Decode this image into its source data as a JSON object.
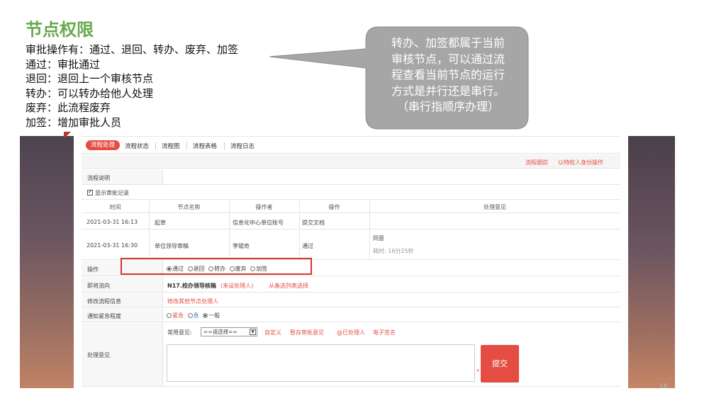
{
  "slide": {
    "title": "节点权限",
    "lines": [
      "审批操作有：通过、退回、转办、废弃、加签",
      "通过：审批通过",
      "退回：退回上一个审核节点",
      "转办：可以转办给他人处理",
      "废弃：此流程废弃",
      "加签：增加审批人员"
    ],
    "callout": [
      "转办、加签都属于当前",
      "审核节点，可以通过流",
      "程查看当前节点的运行",
      "方式是并行还是串行。",
      "（串行指顺序办理）"
    ],
    "page_number": "18"
  },
  "app": {
    "tabs": [
      "流程处理",
      "流程状态",
      "流程图",
      "流程表格",
      "流程日志"
    ],
    "top_links": [
      "流程跟踪",
      "以特权人身份操作"
    ],
    "flow_desc_label": "流程说明",
    "show_records_label": "显示审批记录",
    "table": {
      "headers": [
        "时间",
        "节点名称",
        "操作者",
        "操作",
        "处理意见"
      ],
      "rows": [
        {
          "time": "2021-03-31 16:13",
          "node": "起草",
          "operator": "信息化中心单位账号",
          "action": "提交文档",
          "opinion": "",
          "duration": ""
        },
        {
          "time": "2021-03-31 16:30",
          "node": "单位领导审稿",
          "operator": "李斌奇",
          "action": "通过",
          "opinion": "同意",
          "duration": "耗时: 16分25秒"
        }
      ]
    },
    "operation": {
      "label": "操作",
      "options": [
        "通过",
        "退回",
        "转办",
        "废弃",
        "加签"
      ],
      "selected": "通过"
    },
    "next_flow": {
      "label": "即将流向",
      "node": "N17.校办领导核稿",
      "unset": "(未设处理人)",
      "choose": "从备选列表选择"
    },
    "modify_flow": {
      "label": "修改流程信息",
      "link": "修改其他节点处理人"
    },
    "urgency": {
      "label": "通知紧急程度",
      "options": [
        "紧急",
        "急",
        "一般"
      ],
      "selected": "一般"
    },
    "opinion": {
      "label": "处理意见",
      "common_label": "常用意见:",
      "select_value": "==请选择==",
      "links": [
        "自定义",
        "暂存审批意见",
        "@已处理人",
        "电子签名"
      ],
      "submit": "提交"
    }
  }
}
